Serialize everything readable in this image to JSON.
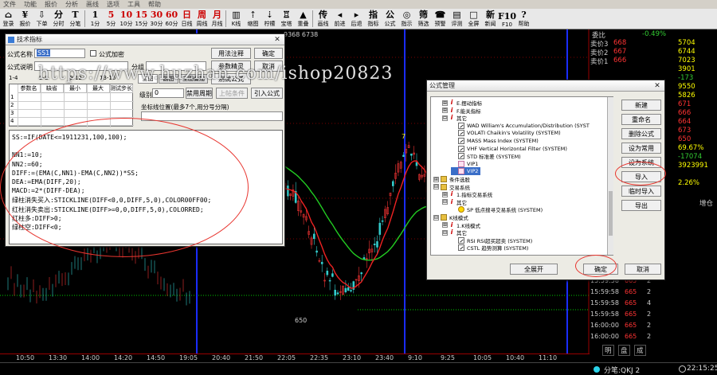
{
  "menu": [
    "文件",
    "功能",
    "报价",
    "分析",
    "画线",
    "选项",
    "工具",
    "帮助"
  ],
  "toolbar": [
    {
      "g": "⌂",
      "t": "登录"
    },
    {
      "g": "¥",
      "t": "报价"
    },
    {
      "g": "⇩",
      "t": "下单"
    },
    {
      "g": "分",
      "t": "分时"
    },
    {
      "g": "T",
      "t": "分笔"
    },
    {
      "g": "1",
      "t": "1分"
    },
    {
      "g": "5",
      "t": "5分",
      "p": true
    },
    {
      "g": "10",
      "t": "10分",
      "p": true
    },
    {
      "g": "15",
      "t": "15分",
      "p": true
    },
    {
      "g": "30",
      "t": "30分",
      "p": true
    },
    {
      "g": "60",
      "t": "60分",
      "p": true
    },
    {
      "g": "日",
      "t": "日线",
      "p": true
    },
    {
      "g": "周",
      "t": "周线",
      "p": true
    },
    {
      "g": "月",
      "t": "月线",
      "p": true
    },
    {
      "g": "▥",
      "t": "K线"
    },
    {
      "g": "⇡",
      "t": "缩图"
    },
    {
      "g": "⇣",
      "t": "柠檬"
    },
    {
      "g": "♖",
      "t": "宝塔"
    },
    {
      "g": "▲",
      "t": "重叠"
    },
    {
      "g": "传",
      "t": "画线"
    },
    {
      "g": "◂",
      "t": "前进"
    },
    {
      "g": "▸",
      "t": "后退"
    },
    {
      "g": "指",
      "t": "指标"
    },
    {
      "g": "公",
      "t": "公式"
    },
    {
      "g": "◎",
      "t": "指示"
    },
    {
      "g": "筛",
      "t": "筛选"
    },
    {
      "g": "☎",
      "t": "预警"
    },
    {
      "g": "▤",
      "t": "评测"
    },
    {
      "g": "□",
      "t": "全屏"
    },
    {
      "g": "新",
      "t": "新闻"
    },
    {
      "g": "F10",
      "t": "F10"
    },
    {
      "g": "?",
      "t": "帮助"
    }
  ],
  "headerDigits": "9368 6738",
  "quotes": {
    "top": {
      "label": "委比",
      "value": "-0.49%"
    },
    "asks": [
      {
        "label": "卖价3",
        "price": "668",
        "vol": "5704"
      },
      {
        "label": "卖价2",
        "price": "667",
        "vol": "6744"
      },
      {
        "label": "卖价1",
        "price": "666",
        "vol": "7023"
      }
    ],
    "column": [
      "3901",
      "-173",
      "9550",
      "5826",
      "671",
      "666",
      "664",
      "673",
      "650",
      "69.67%",
      "-17074",
      "3923991",
      "",
      "2.26%"
    ],
    "ticks_header": "增仓",
    "trades": [
      {
        "time": "15:59:58",
        "price": "665",
        "vol": "2"
      },
      {
        "time": "15:59:58",
        "price": "665",
        "vol": "2"
      },
      {
        "time": "15:59:58",
        "price": "665",
        "vol": "4"
      },
      {
        "time": "15:59:58",
        "price": "665",
        "vol": "2"
      },
      {
        "time": "16:00:00",
        "price": "665",
        "vol": "2"
      },
      {
        "time": "16:00:00",
        "price": "665",
        "vol": "2"
      }
    ],
    "tabs": [
      "明",
      "盘",
      "成"
    ]
  },
  "timeaxis": [
    "10:50",
    "13:30",
    "14:00",
    "14:20",
    "14:50",
    "19:05",
    "20:40",
    "21:50",
    "22:05",
    "22:35",
    "23:10",
    "23:40",
    "9:10",
    "9:25",
    "10:05",
    "10:40",
    "11:10"
  ],
  "status": {
    "code": "分笔:QKJ 2",
    "time": "22:15:25"
  },
  "chartLabels": {
    "peak": "7",
    "low": "650"
  },
  "watermark": "https://www.huzhan.com/ishop20823",
  "tech": {
    "title": "技术指标",
    "name_label": "公式名称",
    "name_value": "SS1",
    "pwd_label": "公式加密",
    "desc_label": "公式说明",
    "group_label": "分组",
    "level_label": "级别",
    "level_value": "0",
    "disable_cycle": "禁用周期",
    "show_label": "坐标线位置(最多7个,用分号分隔)",
    "btn_help": "用法注释",
    "btn_ok": "确定",
    "btn_param": "参数精灵",
    "btn_cancel": "取消",
    "btn_test": "测试公式",
    "btn_import": "引入公式",
    "btn_del": "删除公式",
    "btn_chart": "上帖条件",
    "param_headers": [
      "参数名",
      "缺省",
      "最小",
      "最大",
      "测试步长"
    ],
    "param_rows": [
      "1",
      "2",
      "3",
      "4"
    ],
    "tabs": [
      "1-4",
      "5-8",
      "9-12",
      "13-16"
    ],
    "drawtabs": [
      "主图",
      "副图",
      "主图叠加"
    ],
    "code": [
      "SS:=IF(DATE<=1911231,100,100);",
      "",
      "NN1:=10;",
      "NN2:=60;",
      "DIFF:=(EMA(C,NN1)-EMA(C,NN2))*SS;",
      "DEA:=EMA(DIFF,20);",
      "MACD:=2*(DIFF-DEA);",
      "绿柱消失买入:STICKLINE(DIFF<0,0,DIFF,5,0),COLOR00FF00;",
      "红柱消失卖出:STICKLINE(DIFF>=0,0,DIFF,5,0),COLORRED;",
      "红柱多:DIFF>0;",
      "绿柱空:DIFF<0;"
    ]
  },
  "formula": {
    "title": "公式管理",
    "btn_new": "新建",
    "btn_rename": "重命名",
    "btn_delete": "删除公式",
    "btn_common": "设为常用",
    "btn_sys": "设为系统",
    "btn_import": "导入",
    "btn_temp": "临时导入",
    "btn_export": "导出",
    "btn_expand": "全展开",
    "btn_ok": "确定",
    "btn_cancel": "取消",
    "tree": [
      {
        "lvl": 1,
        "tog": "⊞",
        "ic": "red",
        "t": "E.摆动指标"
      },
      {
        "lvl": 1,
        "tog": "⊞",
        "ic": "red",
        "t": "F.能关指标"
      },
      {
        "lvl": 1,
        "tog": "⊟",
        "ic": "red",
        "t": "其它"
      },
      {
        "lvl": 2,
        "tog": "",
        "ic": "sys",
        "t": "WAD   William's Accumulation/Distribution (SYST"
      },
      {
        "lvl": 2,
        "tog": "",
        "ic": "sys",
        "t": "VOLATI  Chaikin's Volatility (SYSTEM)"
      },
      {
        "lvl": 2,
        "tog": "",
        "ic": "sys",
        "t": "MASS  Mass Index (SYSTEM)"
      },
      {
        "lvl": 2,
        "tog": "",
        "ic": "sys",
        "t": "VHF  Vertical Horizontal Filter (SYSTEM)"
      },
      {
        "lvl": 2,
        "tog": "",
        "ic": "sys",
        "t": "STD  标准差 (SYSTEM)"
      },
      {
        "lvl": 2,
        "tog": "",
        "ic": "usr",
        "t": "VIP1"
      },
      {
        "lvl": 2,
        "tog": "",
        "ic": "usr",
        "t": "VIP2"
      },
      {
        "lvl": 0,
        "tog": "⊞",
        "ic": "fold",
        "t": "条件选股"
      },
      {
        "lvl": 0,
        "tog": "⊟",
        "ic": "fold",
        "t": "交易系统"
      },
      {
        "lvl": 1,
        "tog": "⊞",
        "ic": "red",
        "t": "1.指标交易系统"
      },
      {
        "lvl": 1,
        "tog": "⊟",
        "ic": "red",
        "t": "其它"
      },
      {
        "lvl": 2,
        "tog": "",
        "ic": "star",
        "t": "SP  低点搜寻交易系统 (SYSTEM)"
      },
      {
        "lvl": 0,
        "tog": "⊟",
        "ic": "fold",
        "t": "K线模式"
      },
      {
        "lvl": 1,
        "tog": "⊞",
        "ic": "red",
        "t": "1.K线模式"
      },
      {
        "lvl": 1,
        "tog": "⊟",
        "ic": "red",
        "t": "其它"
      },
      {
        "lvl": 2,
        "tog": "",
        "ic": "sys",
        "t": "RSI  RSI超买超卖 (SYSTEM)"
      },
      {
        "lvl": 2,
        "tog": "",
        "ic": "sys",
        "t": "CSTL  趋势测算 (SYSTEM)"
      }
    ]
  }
}
